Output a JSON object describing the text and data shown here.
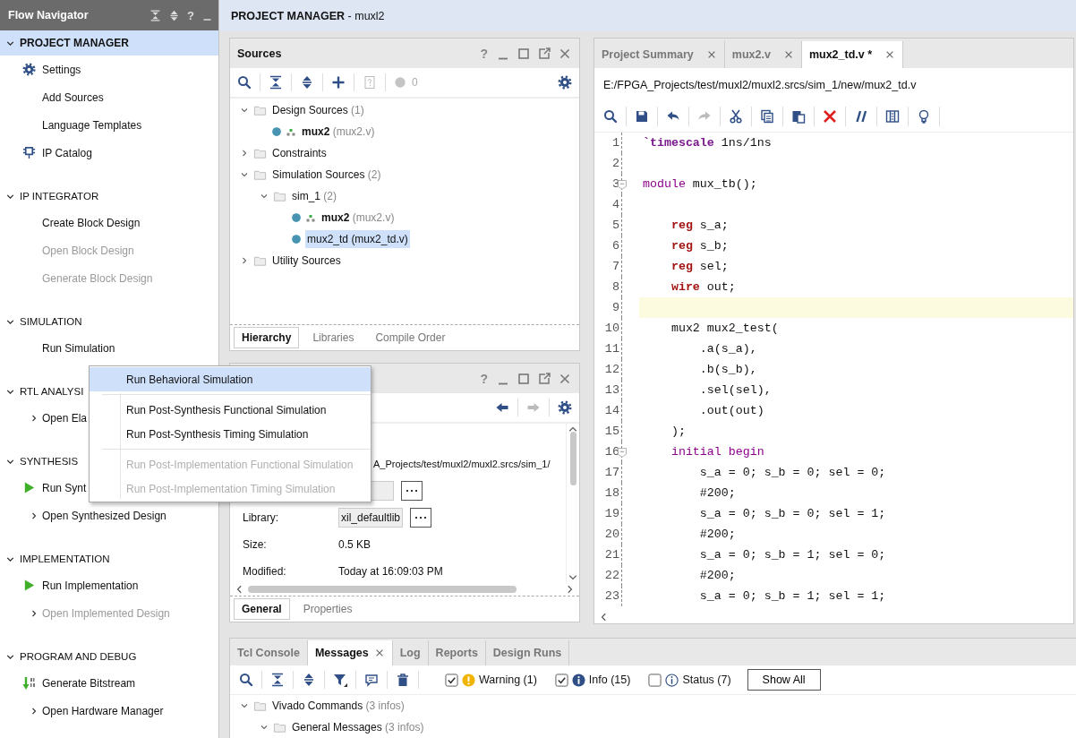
{
  "flow_navigator": {
    "title": "Flow Navigator",
    "help": "?",
    "sections": [
      {
        "title": "PROJECT MANAGER",
        "selected": true,
        "expanded": true,
        "items": [
          {
            "label": "Settings",
            "kind": "gear",
            "disabled": false
          },
          {
            "label": "Add Sources",
            "kind": "plain",
            "disabled": false
          },
          {
            "label": "Language Templates",
            "kind": "plain",
            "disabled": false
          },
          {
            "label": "IP Catalog",
            "kind": "chip",
            "disabled": false
          }
        ]
      },
      {
        "title": "IP INTEGRATOR",
        "selected": false,
        "expanded": true,
        "items": [
          {
            "label": "Create Block Design",
            "kind": "plain",
            "disabled": false
          },
          {
            "label": "Open Block Design",
            "kind": "plain",
            "disabled": true
          },
          {
            "label": "Generate Block Design",
            "kind": "plain",
            "disabled": true
          }
        ]
      },
      {
        "title": "SIMULATION",
        "selected": false,
        "expanded": true,
        "items": [
          {
            "label": "Run Simulation",
            "kind": "plain",
            "disabled": false
          }
        ]
      },
      {
        "title": "RTL ANALYSI",
        "selected": false,
        "expanded": true,
        "items": [
          {
            "label": "Open Ela",
            "kind": "expandable",
            "disabled": false
          }
        ]
      },
      {
        "title": "SYNTHESIS",
        "selected": false,
        "expanded": true,
        "items": [
          {
            "label": "Run Synt",
            "kind": "play",
            "disabled": false
          },
          {
            "label": "Open Synthesized Design",
            "kind": "expandable",
            "disabled": false
          }
        ]
      },
      {
        "title": "IMPLEMENTATION",
        "selected": false,
        "expanded": true,
        "items": [
          {
            "label": "Run Implementation",
            "kind": "play",
            "disabled": false
          },
          {
            "label": "Open Implemented Design",
            "kind": "expandable",
            "disabled": true
          }
        ]
      },
      {
        "title": "PROGRAM AND DEBUG",
        "selected": false,
        "expanded": true,
        "items": [
          {
            "label": "Generate Bitstream",
            "kind": "bitstream",
            "disabled": false
          },
          {
            "label": "Open Hardware Manager",
            "kind": "expandable",
            "disabled": false
          }
        ]
      }
    ]
  },
  "header": {
    "title": "PROJECT MANAGER",
    "subtitle": "- muxl2"
  },
  "sources": {
    "title": "Sources",
    "help": "?",
    "error_count": "0",
    "tree": [
      {
        "kind": "folder",
        "label": "Design Sources",
        "count": "(1)",
        "expanded": true,
        "selected": false,
        "children": [
          {
            "kind": "module",
            "name": "mux2",
            "file": "(mux2.v)",
            "top": true,
            "selected": false
          }
        ]
      },
      {
        "kind": "folder",
        "label": "Constraints",
        "expanded": false,
        "selected": false
      },
      {
        "kind": "folder",
        "label": "Simulation Sources",
        "count": "(2)",
        "expanded": true,
        "selected": false,
        "children": [
          {
            "kind": "folder",
            "label": "sim_1",
            "count": "(2)",
            "expanded": true,
            "selected": false,
            "children": [
              {
                "kind": "module",
                "name": "mux2",
                "file": "(mux2.v)",
                "top": true,
                "selected": false
              },
              {
                "kind": "module",
                "name": "mux2_td",
                "file": "(mux2_td.v)",
                "top": false,
                "selected": true
              }
            ]
          }
        ]
      },
      {
        "kind": "folder",
        "label": "Utility Sources",
        "expanded": false,
        "selected": false
      }
    ],
    "tabs": [
      {
        "label": "Hierarchy",
        "selected": true
      },
      {
        "label": "Libraries",
        "selected": false
      },
      {
        "label": "Compile Order",
        "selected": false
      }
    ]
  },
  "properties": {
    "help": "?",
    "rows": [
      {
        "kind": "path",
        "value": "A_Projects/test/muxl2/muxl2.srcs/sim_1/"
      },
      {
        "kind": "field"
      },
      {
        "kind": "field",
        "label": "Library:",
        "value": "xil_defaultlib"
      },
      {
        "kind": "text",
        "label": "Size:",
        "value": "0.5 KB"
      },
      {
        "kind": "text",
        "label": "Modified:",
        "value": "Today at 16:09:03 PM"
      }
    ],
    "tabs": [
      {
        "label": "General",
        "selected": true
      },
      {
        "label": "Properties",
        "selected": false
      }
    ]
  },
  "editor": {
    "tabs": [
      {
        "label": "Project Summary",
        "selected": false
      },
      {
        "label": "mux2.v",
        "selected": false
      },
      {
        "label": "mux2_td.v *",
        "selected": true
      }
    ],
    "path": "E:/FPGA_Projects/test/muxl2/muxl2.srcs/sim_1/new/mux2_td.v",
    "lines": [
      {
        "number": "1",
        "current": false,
        "fold": false,
        "tokens": [
          {
            "kind": "directive",
            "text": "`timescale"
          },
          {
            "kind": "plain",
            "text": " 1ns/1ns"
          }
        ]
      },
      {
        "number": "2",
        "current": false,
        "fold": false
      },
      {
        "number": "3",
        "current": false,
        "fold": true,
        "tokens": [
          {
            "kind": "keyword",
            "text": "module"
          },
          {
            "kind": "plain",
            "text": " mux_tb();"
          }
        ]
      },
      {
        "number": "4",
        "current": false,
        "fold": false
      },
      {
        "number": "5",
        "current": false,
        "fold": false,
        "tokens": [
          {
            "kind": "type",
            "text": "    reg"
          },
          {
            "kind": "plain",
            "text": " s_a;"
          }
        ]
      },
      {
        "number": "6",
        "current": false,
        "fold": false,
        "tokens": [
          {
            "kind": "type",
            "text": "    reg"
          },
          {
            "kind": "plain",
            "text": " s_b;"
          }
        ]
      },
      {
        "number": "7",
        "current": false,
        "fold": false,
        "tokens": [
          {
            "kind": "type",
            "text": "    reg"
          },
          {
            "kind": "plain",
            "text": " sel;"
          }
        ]
      },
      {
        "number": "8",
        "current": false,
        "fold": false,
        "tokens": [
          {
            "kind": "type",
            "text": "    wire"
          },
          {
            "kind": "plain",
            "text": " out;"
          }
        ]
      },
      {
        "number": "9",
        "current": true,
        "fold": false
      },
      {
        "number": "10",
        "current": false,
        "fold": false,
        "tokens": [
          {
            "kind": "plain",
            "text": "    mux2 mux2_test("
          }
        ]
      },
      {
        "number": "11",
        "current": false,
        "fold": false,
        "tokens": [
          {
            "kind": "plain",
            "text": "        .a(s_a),"
          }
        ]
      },
      {
        "number": "12",
        "current": false,
        "fold": false,
        "tokens": [
          {
            "kind": "plain",
            "text": "        .b(s_b),"
          }
        ]
      },
      {
        "number": "13",
        "current": false,
        "fold": false,
        "tokens": [
          {
            "kind": "plain",
            "text": "        .sel(sel),"
          }
        ]
      },
      {
        "number": "14",
        "current": false,
        "fold": false,
        "tokens": [
          {
            "kind": "plain",
            "text": "        .out(out)"
          }
        ]
      },
      {
        "number": "15",
        "current": false,
        "fold": false,
        "tokens": [
          {
            "kind": "plain",
            "text": "    );"
          }
        ]
      },
      {
        "number": "16",
        "current": false,
        "fold": true,
        "tokens": [
          {
            "kind": "keyword",
            "text": "    initial begin"
          }
        ]
      },
      {
        "number": "17",
        "current": false,
        "fold": false,
        "tokens": [
          {
            "kind": "plain",
            "text": "        s_a = 0; s_b = 0; sel = 0;"
          }
        ]
      },
      {
        "number": "18",
        "current": false,
        "fold": false,
        "tokens": [
          {
            "kind": "plain",
            "text": "        #200;"
          }
        ]
      },
      {
        "number": "19",
        "current": false,
        "fold": false,
        "tokens": [
          {
            "kind": "plain",
            "text": "        s_a = 0; s_b = 0; sel = 1;"
          }
        ]
      },
      {
        "number": "20",
        "current": false,
        "fold": false,
        "tokens": [
          {
            "kind": "plain",
            "text": "        #200;"
          }
        ]
      },
      {
        "number": "21",
        "current": false,
        "fold": false,
        "tokens": [
          {
            "kind": "plain",
            "text": "        s_a = 0; s_b = 1; sel = 0;"
          }
        ]
      },
      {
        "number": "22",
        "current": false,
        "fold": false,
        "tokens": [
          {
            "kind": "plain",
            "text": "        #200;"
          }
        ]
      },
      {
        "number": "23",
        "current": false,
        "fold": false,
        "tokens": [
          {
            "kind": "plain",
            "text": "        s_a = 0; s_b = 1; sel = 1;"
          }
        ]
      }
    ]
  },
  "messages": {
    "tabs": [
      {
        "label": "Tcl Console",
        "selected": false,
        "closable": false
      },
      {
        "label": "Messages",
        "selected": true,
        "closable": true
      },
      {
        "label": "Log",
        "selected": false,
        "closable": false
      },
      {
        "label": "Reports",
        "selected": false,
        "closable": false
      },
      {
        "label": "Design Runs",
        "selected": false,
        "closable": false
      }
    ],
    "filters": [
      {
        "kind": "warning",
        "label": "Warning (1)",
        "checked": true
      },
      {
        "kind": "info",
        "label": "Info (15)",
        "checked": true
      },
      {
        "kind": "status",
        "label": "Status (7)",
        "checked": false
      }
    ],
    "show_all": "Show All",
    "tree": [
      {
        "label": "Vivado Commands",
        "count": "(3 infos)",
        "expanded": true,
        "children": [
          {
            "label": "General Messages",
            "count": "(3 infos)",
            "expanded": true
          }
        ]
      }
    ]
  },
  "context_menu": {
    "items": [
      {
        "kind": "item",
        "label": "Run Behavioral Simulation",
        "selected": true,
        "disabled": false
      },
      {
        "kind": "separator"
      },
      {
        "kind": "item",
        "label": "Run Post-Synthesis Functional Simulation",
        "selected": false,
        "disabled": false
      },
      {
        "kind": "item",
        "label": "Run Post-Synthesis Timing Simulation",
        "selected": false,
        "disabled": false
      },
      {
        "kind": "separator"
      },
      {
        "kind": "item",
        "label": "Run Post-Implementation Functional Simulation",
        "selected": false,
        "disabled": true
      },
      {
        "kind": "item",
        "label": "Run Post-Implementation Timing Simulation",
        "selected": false,
        "disabled": true
      }
    ]
  }
}
